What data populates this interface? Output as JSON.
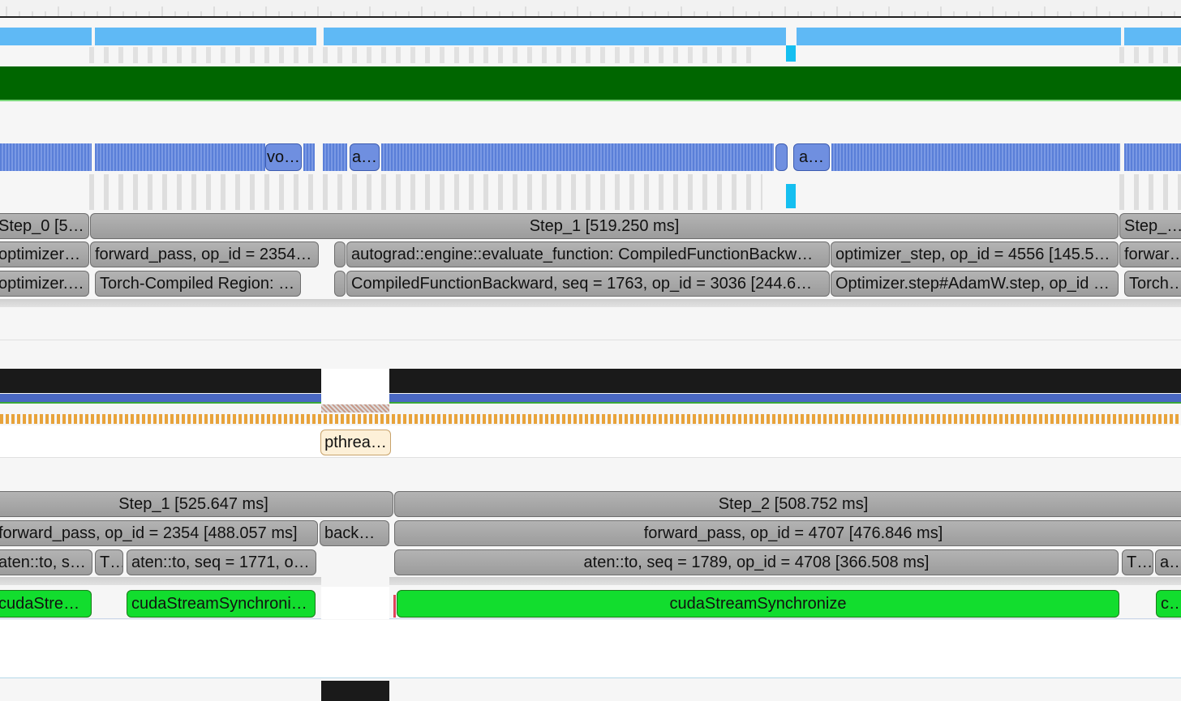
{
  "colors": {
    "sky": "#5fb9f5",
    "dark_green": "#006600",
    "periwinkle": "#6f8fe0",
    "gray_slice": "#a8a8a8",
    "green_slice": "#12dd2e",
    "black_bar": "#1a1a1a",
    "orange_ticks": "#e8a33b",
    "cyan_marker": "#15bff0"
  },
  "icons": [
    "timeline-ruler-icon"
  ],
  "cpu_section": {
    "blue_labels": [
      "vo…",
      "a…",
      "a…"
    ],
    "step_row": [
      {
        "label": "Step_0 [51…"
      },
      {
        "label": "Step_1 [519.250 ms]"
      },
      {
        "label": "Step_2 [5…"
      }
    ],
    "op_row": [
      {
        "label": "optimizer_…"
      },
      {
        "label": "forward_pass, op_id = 2354 …"
      },
      {
        "label": "autograd::engine::evaluate_function: CompiledFunctionBackw…"
      },
      {
        "label": "optimizer_step, op_id = 4556 [145.5…"
      },
      {
        "label": "forward_…"
      }
    ],
    "sub_row": [
      {
        "label": "optimizer.s…"
      },
      {
        "label": "Torch-Compiled Region: …"
      },
      {
        "label": "CompiledFunctionBackward, seq = 1763, op_id = 3036 [244.6…"
      },
      {
        "label": "Optimizer.step#AdamW.step, op_id …"
      },
      {
        "label": "Torch-C…"
      }
    ]
  },
  "thread_section": {
    "pthread_label": "pthrea…",
    "step_row": [
      {
        "label": "Step_1 [525.647 ms]"
      },
      {
        "label": "Step_2 [508.752 ms]"
      }
    ],
    "op_row": [
      {
        "label": "forward_pass, op_id = 2354 [488.057 ms]"
      },
      {
        "label": "backw…"
      },
      {
        "label": "forward_pass, op_id = 4707 [476.846 ms]"
      }
    ],
    "sub_row": [
      {
        "label": "aten::to, se…"
      },
      {
        "label": "T…"
      },
      {
        "label": "aten::to, seq = 1771, o…"
      },
      {
        "label": "aten::to, seq = 1789, op_id = 4708 [366.508 ms]"
      },
      {
        "label": "T…"
      },
      {
        "label": "ate…"
      }
    ],
    "cuda_row": [
      {
        "label": "cudaStrea…"
      },
      {
        "label": "cudaStreamSynchroni…"
      },
      {
        "label": "cudaStreamSynchronize"
      },
      {
        "label": "cu…"
      }
    ]
  }
}
